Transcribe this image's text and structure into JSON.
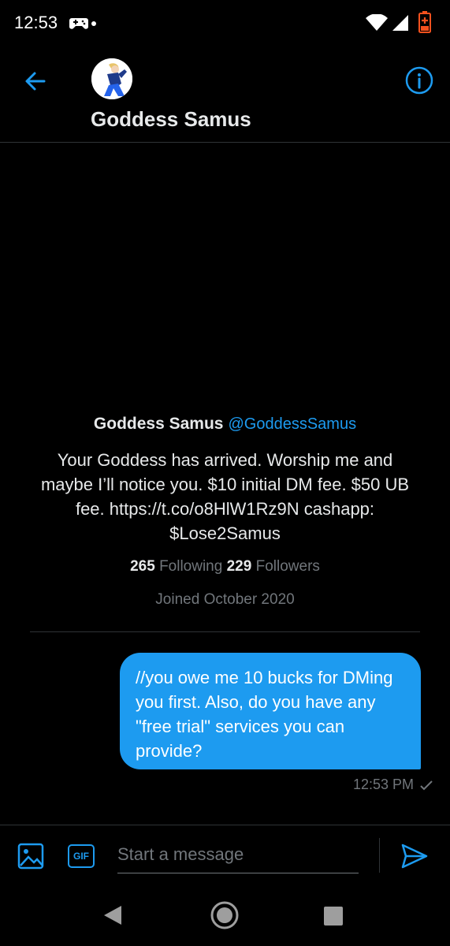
{
  "status_bar": {
    "time": "12:53"
  },
  "header": {
    "contact_name": "Goddess Samus"
  },
  "profile": {
    "name": "Goddess Samus",
    "handle": "@GoddessSamus",
    "bio": "Your Goddess has arrived. Worship me and maybe I’ll notice you. $10 initial DM fee. $50 UB fee. https://t.co/o8HlW1Rz9N cashapp: $Lose2Samus",
    "following_count": "265",
    "following_label": "Following",
    "followers_count": "229",
    "followers_label": "Followers",
    "joined": "Joined October 2020"
  },
  "messages": [
    {
      "text": "//you owe me 10 bucks for DMing you first. Also, do you have any \"free trial\" services you can provide?",
      "time": "12:53 PM"
    }
  ],
  "composer": {
    "placeholder": "Start a message",
    "gif_label": "GIF"
  },
  "colors": {
    "accent": "#1d9bf0",
    "background": "#000000",
    "muted": "#71767b"
  }
}
